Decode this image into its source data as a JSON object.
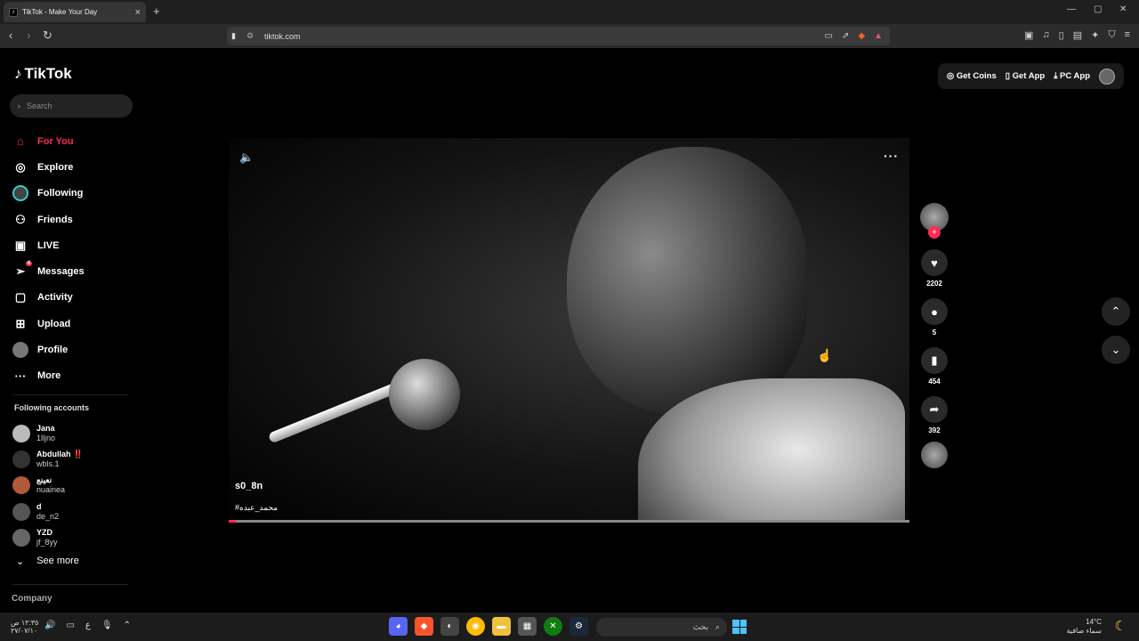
{
  "browser": {
    "tab_title": "TikTok - Make Your Day",
    "url": "tiktok.com"
  },
  "sidebar": {
    "logo": "TikTok",
    "search_placeholder": "Search",
    "nav": [
      {
        "label": "For You",
        "icon": "home-icon"
      },
      {
        "label": "Explore",
        "icon": "compass-icon"
      },
      {
        "label": "Following",
        "icon": "following-avatar-icon"
      },
      {
        "label": "Friends",
        "icon": "friends-icon"
      },
      {
        "label": "LIVE",
        "icon": "live-icon"
      },
      {
        "label": "Messages",
        "icon": "messages-icon",
        "badge": "4"
      },
      {
        "label": "Activity",
        "icon": "activity-icon"
      },
      {
        "label": "Upload",
        "icon": "upload-icon"
      },
      {
        "label": "Profile",
        "icon": "profile-avatar-icon"
      },
      {
        "label": "More",
        "icon": "more-icon"
      }
    ],
    "following_title": "Following accounts",
    "accounts": [
      {
        "name": "Jana",
        "user": "1lljno"
      },
      {
        "name": "Abdullah ‼️",
        "user": "wbls.1"
      },
      {
        "name": "نعينع",
        "user": "nuainea"
      },
      {
        "name": "d",
        "user": "de_n2"
      },
      {
        "name": "YZD",
        "user": "jf_8yy"
      }
    ],
    "see_more": "See more",
    "company": "Company"
  },
  "topbar": {
    "get_coins": "Get Coins",
    "get_app": "Get App",
    "pc_app": "PC App"
  },
  "video": {
    "username": "s0_8n",
    "hashtag": "#محمد_عبده",
    "progress": 0.01
  },
  "actions": {
    "likes": "2202",
    "comments": "5",
    "saves": "454",
    "shares": "392"
  },
  "taskbar": {
    "time": "١٢:٣٥ ص",
    "date": "٢٧/٠٧/١٠",
    "search_text": "بحث",
    "temp": "14°C",
    "weather": "سماء صافية"
  }
}
